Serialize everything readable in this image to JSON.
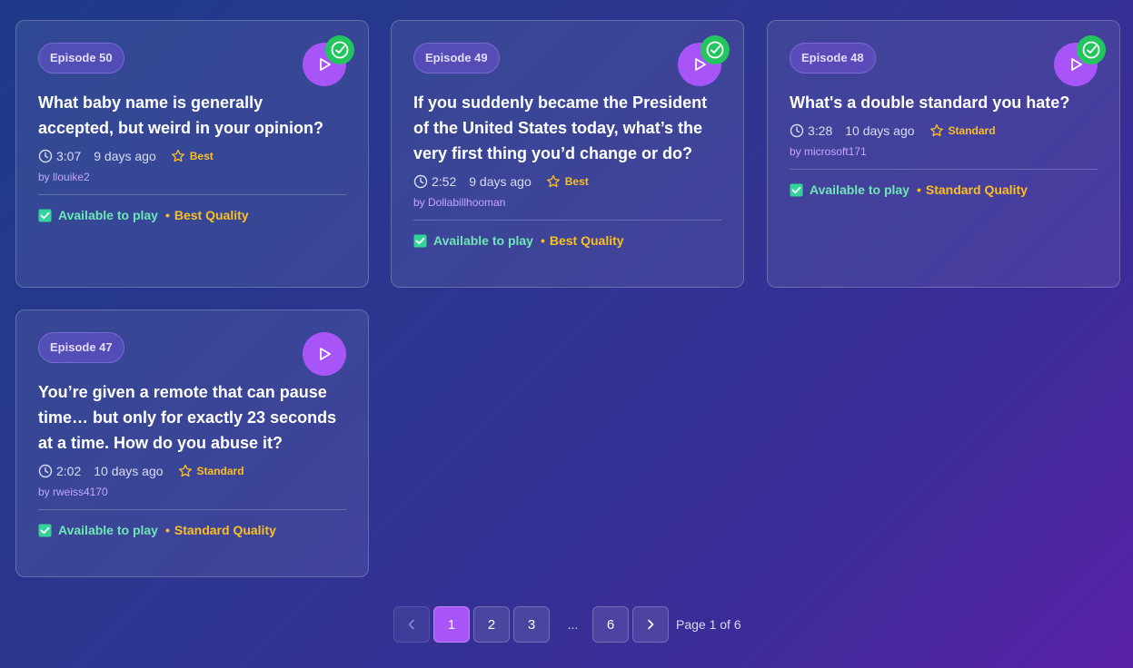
{
  "episodes": [
    {
      "badge": "Episode 50",
      "title": "What baby name is generally accepted, but weird in your opinion?",
      "duration": "3:07",
      "ago": "9 days ago",
      "quality_tag": "Best",
      "author": "by llouike2",
      "available": "Available to play",
      "quality_label": "Best Quality",
      "played": true
    },
    {
      "badge": "Episode 49",
      "title": "If you suddenly became the President of the United States today, what’s the very first thing you’d change or do?",
      "duration": "2:52",
      "ago": "9 days ago",
      "quality_tag": "Best",
      "author": "by Dollabillhooman",
      "available": "Available to play",
      "quality_label": "Best Quality",
      "played": true
    },
    {
      "badge": "Episode 48",
      "title": "What's a double standard you hate?",
      "duration": "3:28",
      "ago": "10 days ago",
      "quality_tag": "Standard",
      "author": "by microsoft171",
      "available": "Available to play",
      "quality_label": "Standard Quality",
      "played": true
    },
    {
      "badge": "Episode 47",
      "title": "You’re given a remote that can pause time… but only for exactly 23 seconds at a time. How do you abuse it?",
      "duration": "2:02",
      "ago": "10 days ago",
      "quality_tag": "Standard",
      "author": "by rweiss4170",
      "available": "Available to play",
      "quality_label": "Standard Quality",
      "played": false
    }
  ],
  "pagination": {
    "pages": [
      "1",
      "2",
      "3",
      "6"
    ],
    "ellipsis": "...",
    "current": "1",
    "info": "Page 1 of 6"
  },
  "colors": {
    "accent": "#a855f7",
    "played_badge": "#22c55e",
    "available": "#6ee7b7",
    "quality": "#fbbf24"
  },
  "icons": [
    "play-icon",
    "check-circle-icon",
    "clock-icon",
    "star-icon",
    "checkbox-checked-icon",
    "chevron-left-icon",
    "chevron-right-icon"
  ]
}
